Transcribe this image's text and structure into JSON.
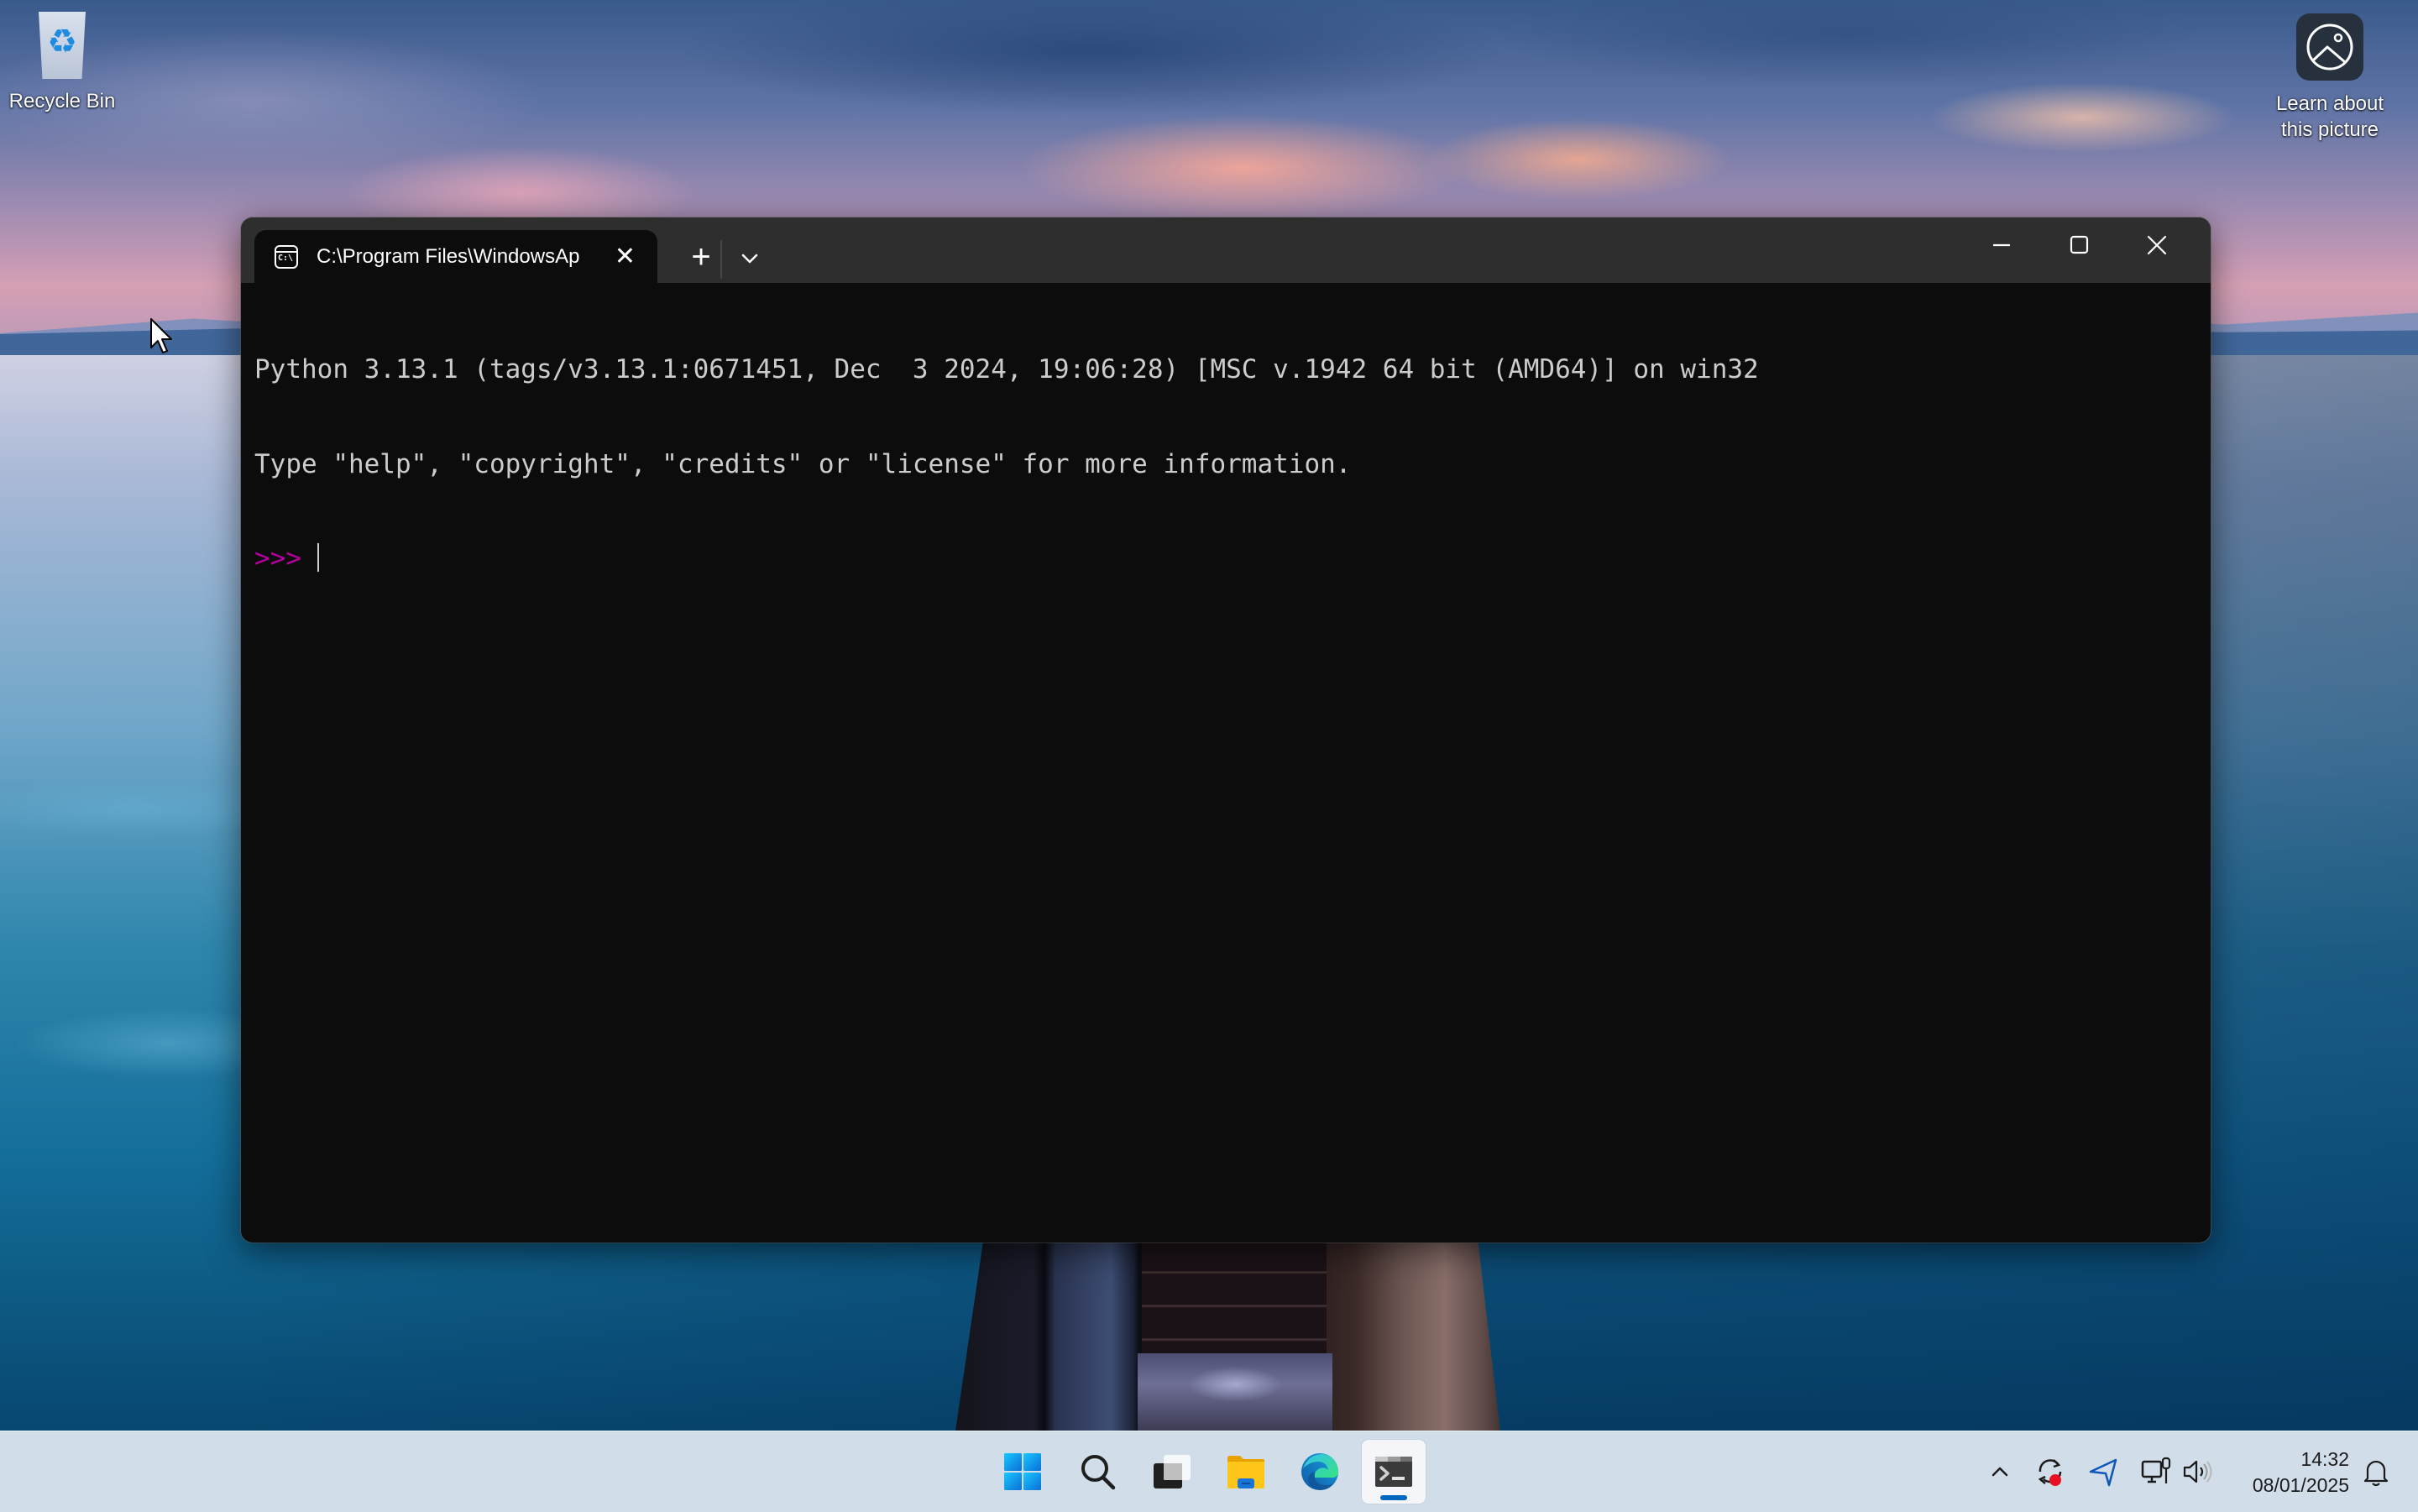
{
  "desktop": {
    "icons": [
      {
        "label": "Recycle Bin",
        "icon": "recycle-bin-icon"
      },
      {
        "label_line1": "Learn about",
        "label_line2": "this picture",
        "icon": "picture-info-icon"
      }
    ]
  },
  "terminal": {
    "tab": {
      "icon": "command-prompt-icon",
      "icon_text": "C:\\",
      "title": "C:\\Program Files\\WindowsAp",
      "close_glyph": "✕"
    },
    "new_tab_glyph": "+",
    "window_controls": [
      "minimize",
      "maximize",
      "close"
    ],
    "console": {
      "lines": [
        "Python 3.13.1 (tags/v3.13.1:0671451, Dec  3 2024, 19:06:28) [MSC v.1942 64 bit (AMD64)] on win32",
        "Type \"help\", \"copyright\", \"credits\" or \"license\" for more information."
      ],
      "prompt": ">>> ",
      "input": ""
    },
    "colors": {
      "background": "#0c0c0c",
      "titlebar": "#2e2e2e",
      "foreground": "#cccccc",
      "prompt": "#b4009e"
    }
  },
  "taskbar": {
    "apps": [
      {
        "name": "Start",
        "icon": "windows-start-icon"
      },
      {
        "name": "Search",
        "icon": "search-icon"
      },
      {
        "name": "Task View",
        "icon": "task-view-icon"
      },
      {
        "name": "File Explorer",
        "icon": "folder-icon"
      },
      {
        "name": "Microsoft Edge",
        "icon": "edge-icon"
      },
      {
        "name": "Terminal",
        "icon": "terminal-icon",
        "active": true
      }
    ],
    "tray": {
      "icons": [
        "chevron-up-icon",
        "sync-icon",
        "location-icon",
        "network-icon",
        "volume-icon"
      ],
      "time": "14:32",
      "date": "08/01/2025",
      "notification_icon": "bell-icon"
    },
    "accent": "#0067c0"
  }
}
